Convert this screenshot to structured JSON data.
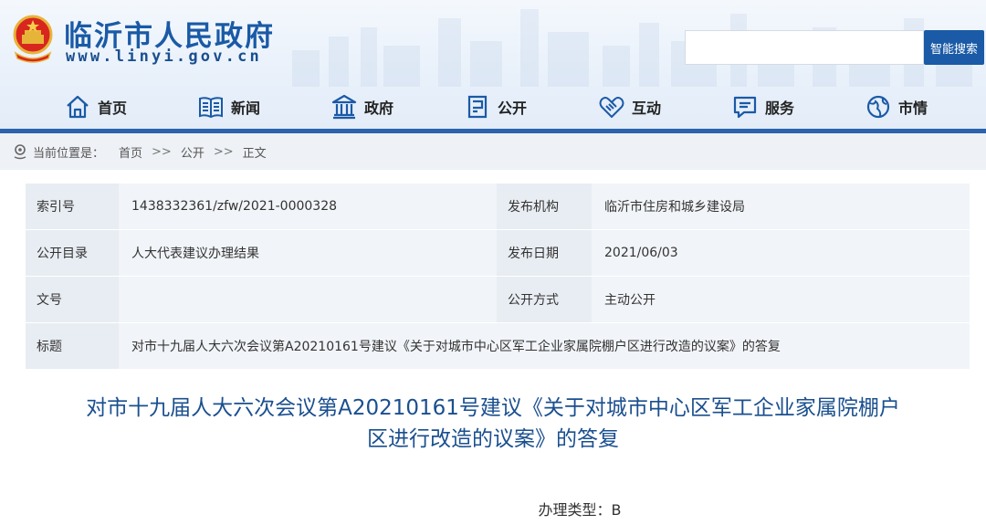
{
  "header": {
    "site_name": "临沂市人民政府",
    "site_url": "www.linyi.gov.cn",
    "search": {
      "placeholder": "",
      "button_label": "智能搜索"
    }
  },
  "nav": {
    "items": [
      {
        "label": "首页",
        "icon": "home-icon"
      },
      {
        "label": "新闻",
        "icon": "book-icon"
      },
      {
        "label": "政府",
        "icon": "building-icon"
      },
      {
        "label": "公开",
        "icon": "document-icon"
      },
      {
        "label": "互动",
        "icon": "handshake-icon"
      },
      {
        "label": "服务",
        "icon": "chat-icon"
      },
      {
        "label": "市情",
        "icon": "globe-icon"
      }
    ]
  },
  "breadcrumb": {
    "prefix": "当前位置是：",
    "items": [
      "首页",
      "公开",
      "正文"
    ],
    "separator": ">>"
  },
  "info": {
    "rows": [
      {
        "label1": "索引号",
        "value1": "1438332361/zfw/2021-0000328",
        "label2": "发布机构",
        "value2": "临沂市住房和城乡建设局"
      },
      {
        "label1": "公开目录",
        "value1": "人大代表建议办理结果",
        "label2": "发布日期",
        "value2": "2021/06/03"
      },
      {
        "label1": "文号",
        "value1": "",
        "label2": "公开方式",
        "value2": "主动公开"
      }
    ],
    "title_label": "标题",
    "title_value": "对市十九届人大六次会议第A20210161号建议《关于对城市中心区军工企业家属院棚户区进行改造的议案》的答复"
  },
  "article": {
    "title_line1": "对市十九届人大六次会议第A20210161号建议《关于对城市中心区军工企业家属院棚户",
    "title_line2": "区进行改造的议案》的答复",
    "process_type": "办理类型：B"
  },
  "colors": {
    "brand_blue": "#1a5aa6",
    "nav_bar": "#2b63ad",
    "label_bg": "#e8edf3",
    "value_bg": "#f1f4f8"
  }
}
